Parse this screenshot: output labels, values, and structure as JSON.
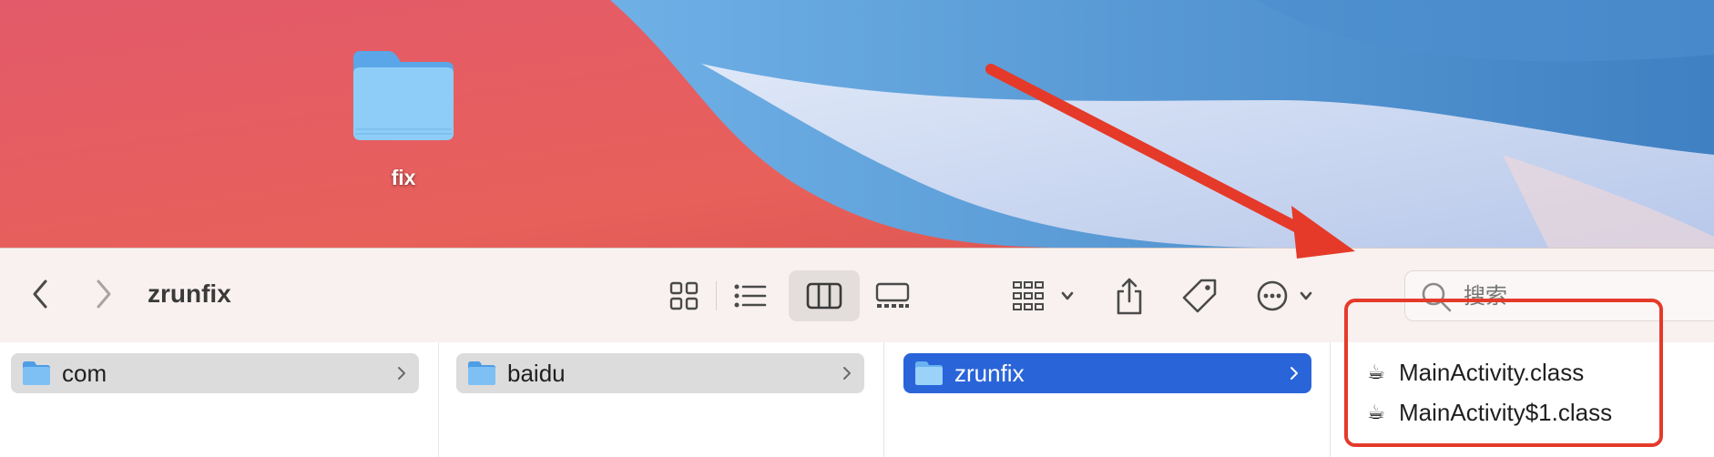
{
  "desktop": {
    "folder_label": "fix"
  },
  "toolbar": {
    "title": "zrunfix",
    "search_placeholder": "搜索"
  },
  "columns": [
    {
      "label": "com",
      "state": "parent"
    },
    {
      "label": "baidu",
      "state": "parent"
    },
    {
      "label": "zrunfix",
      "state": "selected"
    }
  ],
  "files": [
    {
      "label": "MainActivity.class",
      "icon": "java-class-icon"
    },
    {
      "label": "MainActivity$1.class",
      "icon": "java-class-icon"
    }
  ],
  "colors": {
    "selection": "#2a64d9",
    "annotation": "#e53a2a",
    "toolbar_bg": "#f8f1ef"
  }
}
